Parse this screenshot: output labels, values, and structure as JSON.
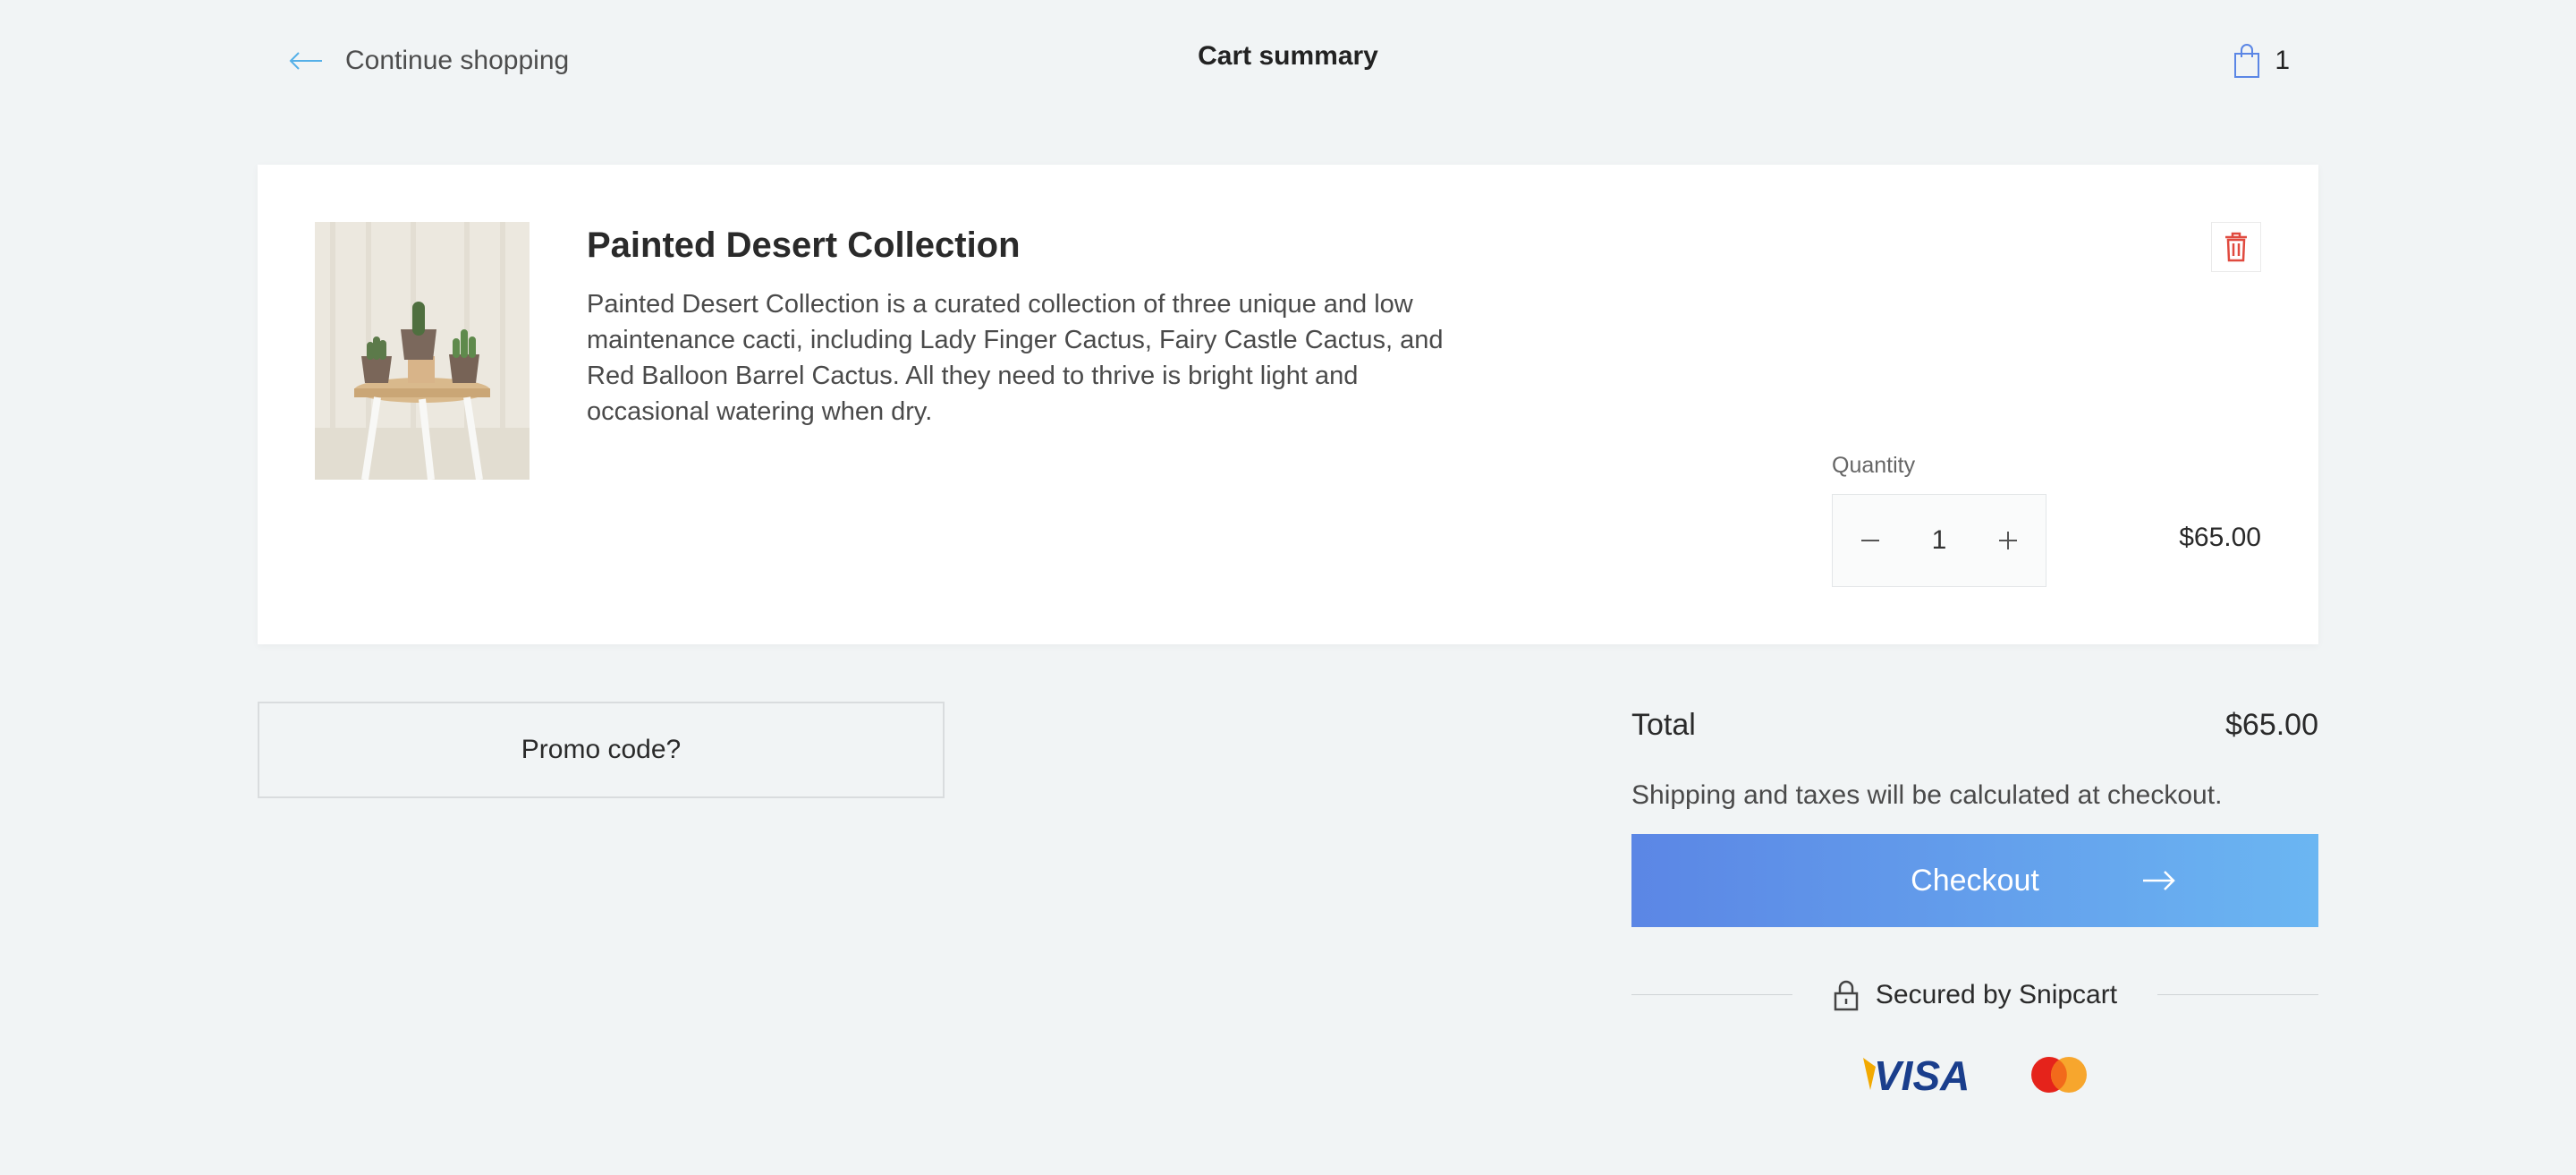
{
  "header": {
    "continue_label": "Continue shopping",
    "title": "Cart summary",
    "cart_count": "1"
  },
  "item": {
    "name": "Painted Desert Collection",
    "description": "Painted Desert Collection is a curated collection of three unique and low maintenance cacti, including Lady Finger Cactus, Fairy Castle Cactus, and Red Balloon Barrel Cactus. All they need to thrive is bright light and occasional watering when dry.",
    "quantity_label": "Quantity",
    "quantity": "1",
    "price": "$65.00"
  },
  "promo": {
    "label": "Promo code?"
  },
  "summary": {
    "total_label": "Total",
    "total_value": "$65.00",
    "shipping_note": "Shipping and taxes will be calculated at checkout.",
    "checkout_label": "Checkout",
    "secured_label": "Secured by Snipcart"
  },
  "icons": {
    "back": "arrow-left-icon",
    "cart": "shopping-bag-icon",
    "delete": "trash-icon",
    "minus": "minus-icon",
    "plus": "plus-icon",
    "checkout_arrow": "arrow-right-icon",
    "lock": "lock-icon",
    "visa": "visa-logo",
    "mastercard": "mastercard-logo"
  },
  "colors": {
    "background": "#f1f4f5",
    "accent_blue": "#5b86e5",
    "accent_light_blue": "#6bb6f2",
    "delete_red": "#e04a3f"
  },
  "payment_logos": {
    "visa_text": "VISA"
  }
}
